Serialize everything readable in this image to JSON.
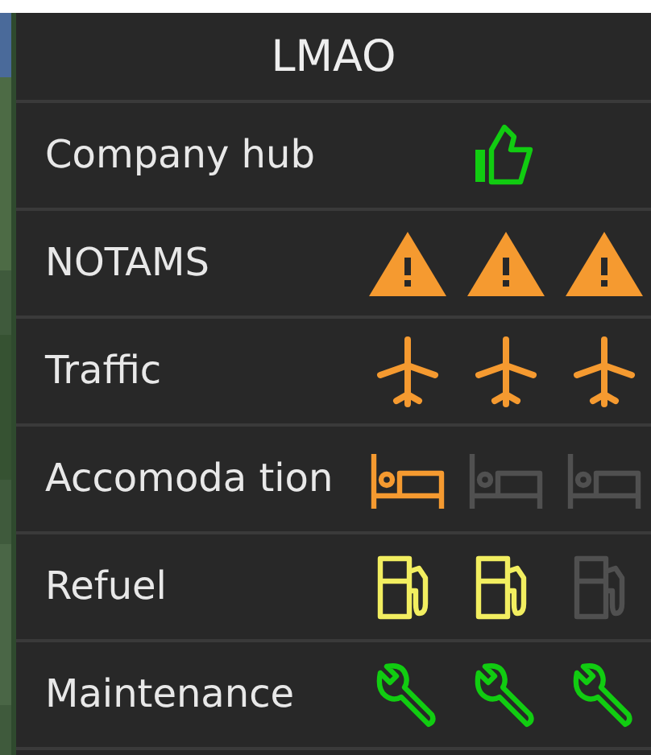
{
  "title": "LMAO",
  "rows": [
    {
      "label": "Company hub",
      "kind": "thumb",
      "color": "#11cc11",
      "icons": [
        {
          "active": true
        }
      ]
    },
    {
      "label": "NOTAMS",
      "kind": "warning",
      "color": "#f59a30",
      "icons": [
        {
          "active": true
        },
        {
          "active": true
        },
        {
          "active": true
        }
      ]
    },
    {
      "label": "Traffic",
      "kind": "plane",
      "color": "#f59a30",
      "icons": [
        {
          "active": true
        },
        {
          "active": true
        },
        {
          "active": true
        }
      ]
    },
    {
      "label": "Accomoda tion",
      "kind": "bed",
      "color": "#f59a30",
      "icons": [
        {
          "active": true
        },
        {
          "active": false
        },
        {
          "active": false
        }
      ]
    },
    {
      "label": "Refuel",
      "kind": "fuel",
      "color": "#f2ee60",
      "icons": [
        {
          "active": true
        },
        {
          "active": true
        },
        {
          "active": false
        }
      ]
    },
    {
      "label": "Maintenance",
      "kind": "wrench",
      "color": "#11cc11",
      "icons": [
        {
          "active": true
        },
        {
          "active": true
        },
        {
          "active": true
        }
      ]
    }
  ]
}
